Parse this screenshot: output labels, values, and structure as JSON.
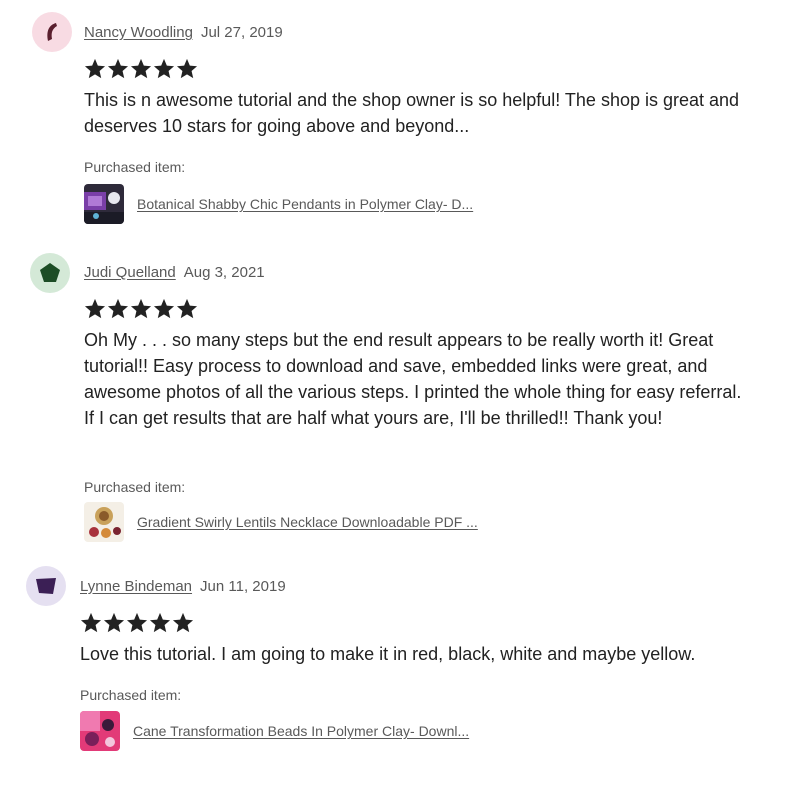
{
  "rating_stars": 5,
  "purchased_label": "Purchased item:",
  "reviews": [
    {
      "reviewer": "Nancy Woodling",
      "date": "Jul 27, 2019",
      "rating": 5,
      "text": "This is n awesome tutorial and the shop owner is so helpful! The shop is great and deserves 10 stars for going above and beyond...",
      "avatar_icon": "shape-avatar-icon",
      "avatar_bg": "#f8dbe3",
      "avatar_color": "#5a1f2e",
      "item_title": "Botanical Shabby Chic Pendants in Polymer Clay- D..."
    },
    {
      "reviewer": "Judi Quelland",
      "date": "Aug 3, 2021",
      "rating": 5,
      "text": "Oh My . . . so many steps but the end result appears to be really worth it! Great tutorial!! Easy process to download and save, embedded links were great, and awesome photos of all the various steps. I printed the whole thing for easy referral. If I can get results that are half what yours are, I'll be thrilled!! Thank you!",
      "avatar_icon": "pentagon-avatar-icon",
      "avatar_bg": "#d4e9d7",
      "avatar_color": "#1c4d25",
      "item_title": "Gradient Swirly Lentils Necklace Downloadable PDF ..."
    },
    {
      "reviewer": "Lynne Bindeman",
      "date": "Jun 11, 2019",
      "rating": 5,
      "text": "Love this tutorial. I am going to make it in red, black, white and maybe yellow.",
      "avatar_icon": "trapezoid-avatar-icon",
      "avatar_bg": "#e5e0f1",
      "avatar_color": "#3b1f55",
      "item_title": "Cane Transformation Beads In Polymer Clay- Downl..."
    }
  ],
  "colors": {
    "text": "#222222",
    "muted": "#595959",
    "star": "#222222"
  }
}
